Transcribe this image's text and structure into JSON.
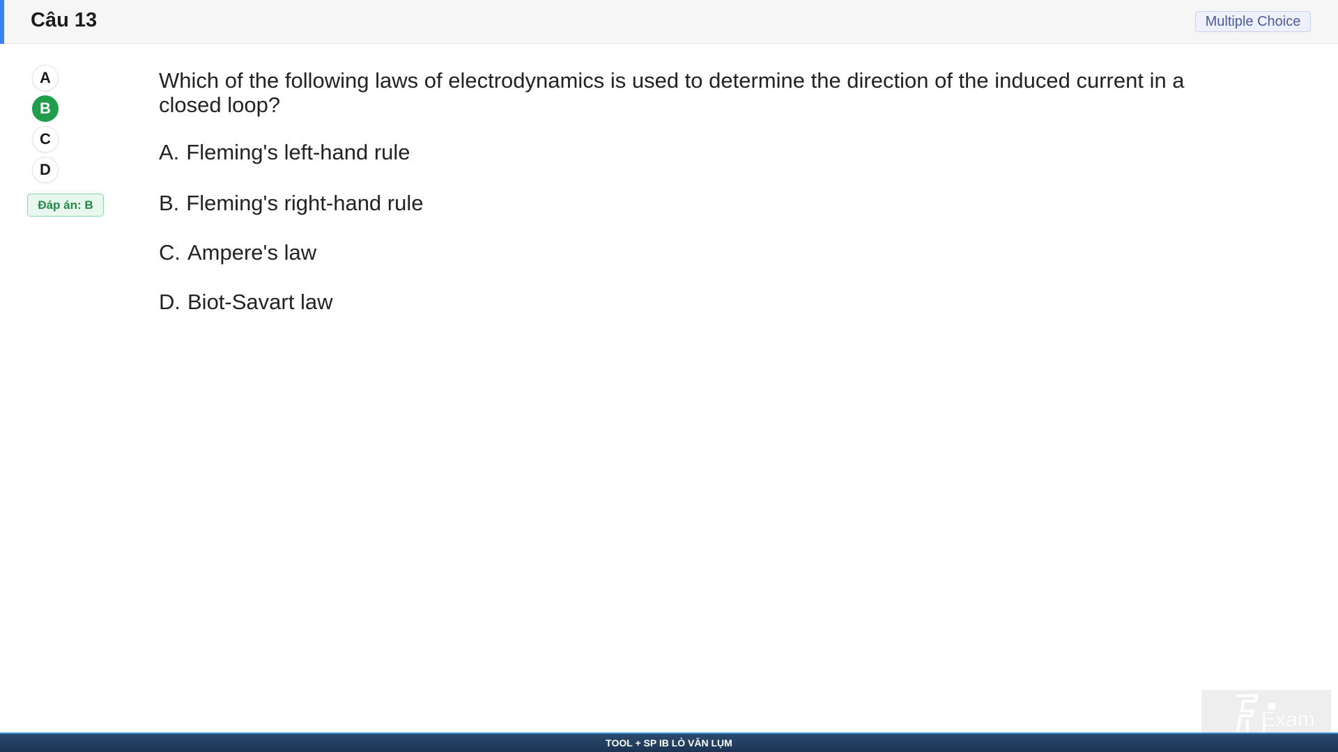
{
  "header": {
    "title": "Câu 13",
    "type_badge": "Multiple Choice",
    "accent_color": "#3b82f6"
  },
  "choices": [
    {
      "label": "A",
      "selected": false
    },
    {
      "label": "B",
      "selected": true
    },
    {
      "label": "C",
      "selected": false
    },
    {
      "label": "D",
      "selected": false
    }
  ],
  "answer_badge": "Đáp án: B",
  "question": {
    "text": "Which of the following laws of electrodynamics is used to determine the direction of the induced current in a closed loop?",
    "options": [
      {
        "letter": "A.",
        "text": "Fleming's left-hand rule"
      },
      {
        "letter": "B.",
        "text": "Fleming's right-hand rule"
      },
      {
        "letter": "C.",
        "text": "Ampere's law"
      },
      {
        "letter": "D.",
        "text": "Biot-Savart law"
      }
    ]
  },
  "watermark": {
    "text": "Exam",
    "icon": "fu-logo-icon"
  },
  "footer": {
    "text": "TOOL + SP IB LÒ VĂN LỤM"
  },
  "colors": {
    "selected_green": "#1f9d4c",
    "footer_bg": "#1d3553"
  }
}
